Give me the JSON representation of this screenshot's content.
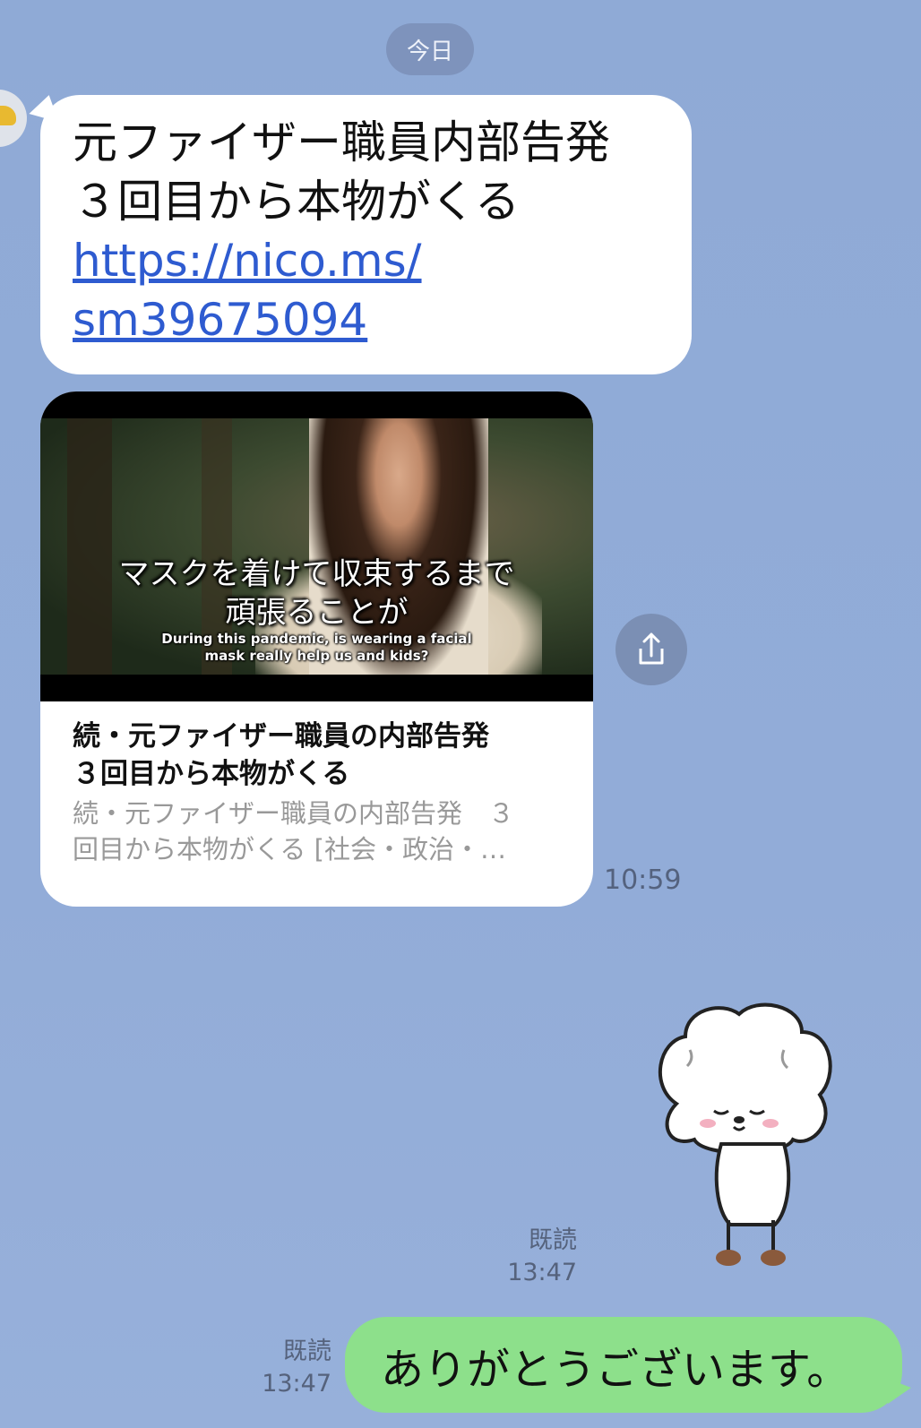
{
  "date_separator": "今日",
  "incoming": {
    "text_line1": "元ファイザー職員内部告発",
    "text_line2": "３回目から本物がくる",
    "link_line1": "https://nico.ms/",
    "link_line2": "sm39675094",
    "preview": {
      "subtitle_jp_line1": "マスクを着けて収束するまで",
      "subtitle_jp_line2": "頑張ることが",
      "subtitle_en_line1": "During this pandemic, is wearing a facial",
      "subtitle_en_line2": "mask really help us and kids?",
      "title_line1": "続・元ファイザー職員の内部告発",
      "title_line2": "３回目から本物がくる",
      "desc_line1": "続・元ファイザー職員の内部告発　３",
      "desc_line2": "回目から本物がくる [社会・政治・…"
    },
    "time": "10:59",
    "share_icon": "share-icon"
  },
  "outgoing": {
    "sticker_name": "bowing-sheep-sticker",
    "sticker_read_label": "既読",
    "sticker_time": "13:47",
    "message": "ありがとうございます。",
    "message_read_label": "既読",
    "message_time": "13:47"
  },
  "colors": {
    "background": "#8faad6",
    "outgoing_bubble": "#8de08b",
    "incoming_bubble": "#ffffff",
    "link": "#2e5bd0"
  }
}
